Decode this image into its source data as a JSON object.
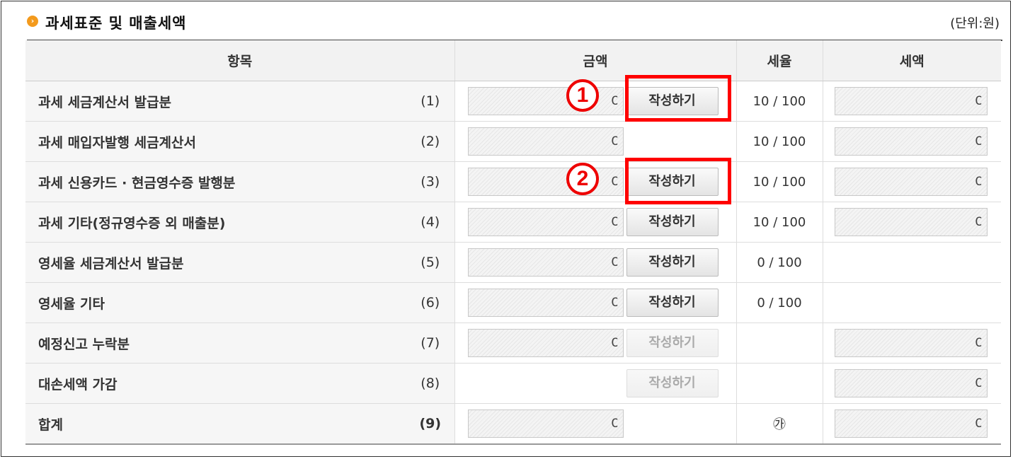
{
  "section": {
    "bullet": "›",
    "title": "과세표준 및 매출세액",
    "unit": "(단위:원)"
  },
  "headers": {
    "item": "항목",
    "amount": "금액",
    "rate": "세율",
    "tax": "세액"
  },
  "rows": [
    {
      "label": "과세 세금계산서 발급분",
      "num": "(1)",
      "amount": "C",
      "button": "작성하기",
      "rate": "10 / 100",
      "tax": "C"
    },
    {
      "label": "과세 매입자발행 세금계산서",
      "num": "(2)",
      "amount": "C",
      "rate": "10 / 100",
      "tax": "C"
    },
    {
      "label": "과세 신용카드 · 현금영수증 발행분",
      "num": "(3)",
      "amount": "C",
      "button": "작성하기",
      "rate": "10 / 100",
      "tax": "C"
    },
    {
      "label": "과세 기타(정규영수증 외 매출분)",
      "num": "(4)",
      "amount": "C",
      "button": "작성하기",
      "rate": "10 / 100",
      "tax": "C"
    },
    {
      "label": "영세율 세금계산서 발급분",
      "num": "(5)",
      "amount": "C",
      "button": "작성하기",
      "rate": "0 / 100"
    },
    {
      "label": "영세율 기타",
      "num": "(6)",
      "amount": "C",
      "button": "작성하기",
      "rate": "0 / 100"
    },
    {
      "label": "예정신고 누락분",
      "num": "(7)",
      "amount": "C",
      "button": "작성하기",
      "tax": "C"
    },
    {
      "label": "대손세액 가감",
      "num": "(8)",
      "button": "작성하기",
      "tax": "C"
    },
    {
      "label": "합계",
      "num": "(9)",
      "amount": "C",
      "rate_mark": "㉮",
      "tax": "C"
    }
  ],
  "annotations": {
    "marker1": "1",
    "marker2": "2"
  },
  "colors": {
    "highlight": "#ff0000",
    "bullet": "#f39a1d"
  }
}
